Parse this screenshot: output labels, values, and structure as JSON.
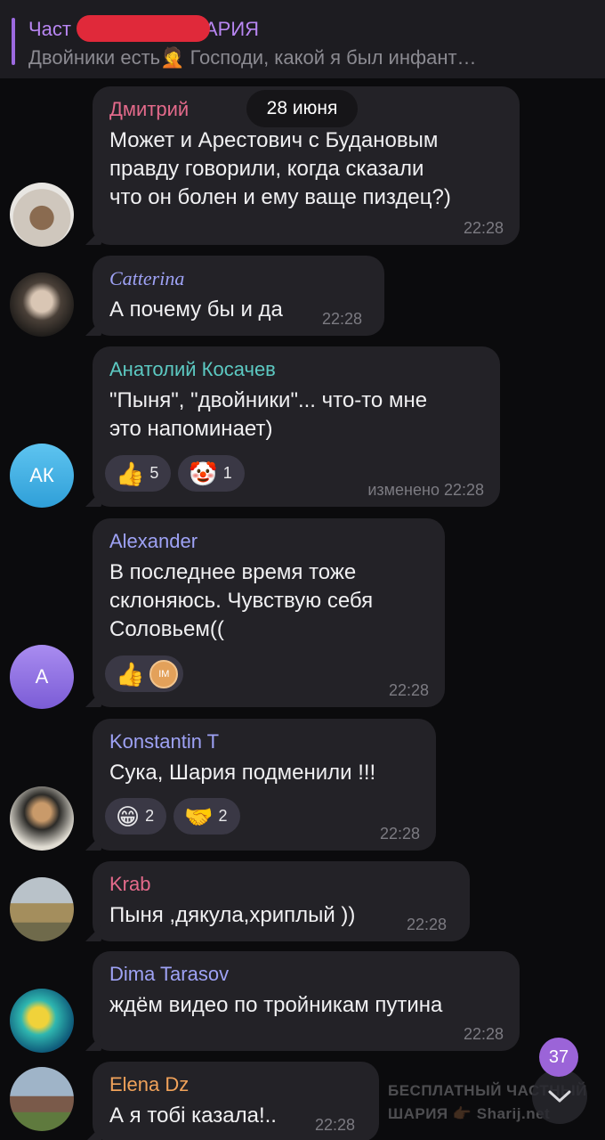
{
  "pinned": {
    "title_start": "Част",
    "title_end": "АРИЯ",
    "preview": "Двойники есть🤦 Господи, какой я был инфант…"
  },
  "date_chip": "28 июня",
  "messages": [
    {
      "author": "Дмитрий",
      "author_color": "#e46a8b",
      "text": "Может и Арестович с Будановым\nправду говорили, когда сказали\nчто он болен и ему ваще пиздец?)",
      "time": "22:28"
    },
    {
      "author": "Catterina",
      "author_color": "#9ea2f5",
      "text": "А почему бы и да",
      "time": "22:28"
    },
    {
      "author": "Анатолий Косачев",
      "author_color": "#5cc9c2",
      "text": "\"Пыня\", \"двойники\"... что-то мне\nэто напоминает)",
      "time": "изменено 22:28",
      "avatar_initials": "АК",
      "reactions": [
        {
          "emoji": "👍",
          "count": "5"
        },
        {
          "emoji": "🤡",
          "count": "1"
        }
      ]
    },
    {
      "author": "Alexander",
      "author_color": "#9ea2f5",
      "text": "В последнее время тоже\nсклоняюсь. Чувствую себя\nСоловьем((",
      "time": "22:28",
      "avatar_initials": "A",
      "reactions": [
        {
          "emoji": "👍",
          "badge": "IM"
        }
      ]
    },
    {
      "author": "Konstantin T",
      "author_color": "#9ea2f5",
      "text": "Сука, Шария подменили  !!!",
      "time": "22:28",
      "reactions": [
        {
          "emoji": "😁",
          "count": "2"
        },
        {
          "emoji": "🤝",
          "count": "2"
        }
      ]
    },
    {
      "author": "Krab",
      "author_color": "#e46a8b",
      "text": "Пыня ,дякула,хриплый ))",
      "time": "22:28"
    },
    {
      "author": "Dima Tarasov",
      "author_color": "#9ea2f5",
      "text": "ждём видео по тройникам путина",
      "time": "22:28"
    },
    {
      "author": "Elena Dz",
      "author_color": "#f0a25a",
      "text": "А я тобі казала!..",
      "time": "22:28"
    }
  ],
  "unread_count": "37",
  "watermark": {
    "line1": "БЕСПЛАТНЫЙ ЧАСТНЫЙ",
    "line2": "ШАРИЯ 👉🏾 Sharij.net"
  },
  "colors": {
    "background": "#0b0b0d",
    "bubble": "#232227",
    "accent": "#9b64d8"
  }
}
